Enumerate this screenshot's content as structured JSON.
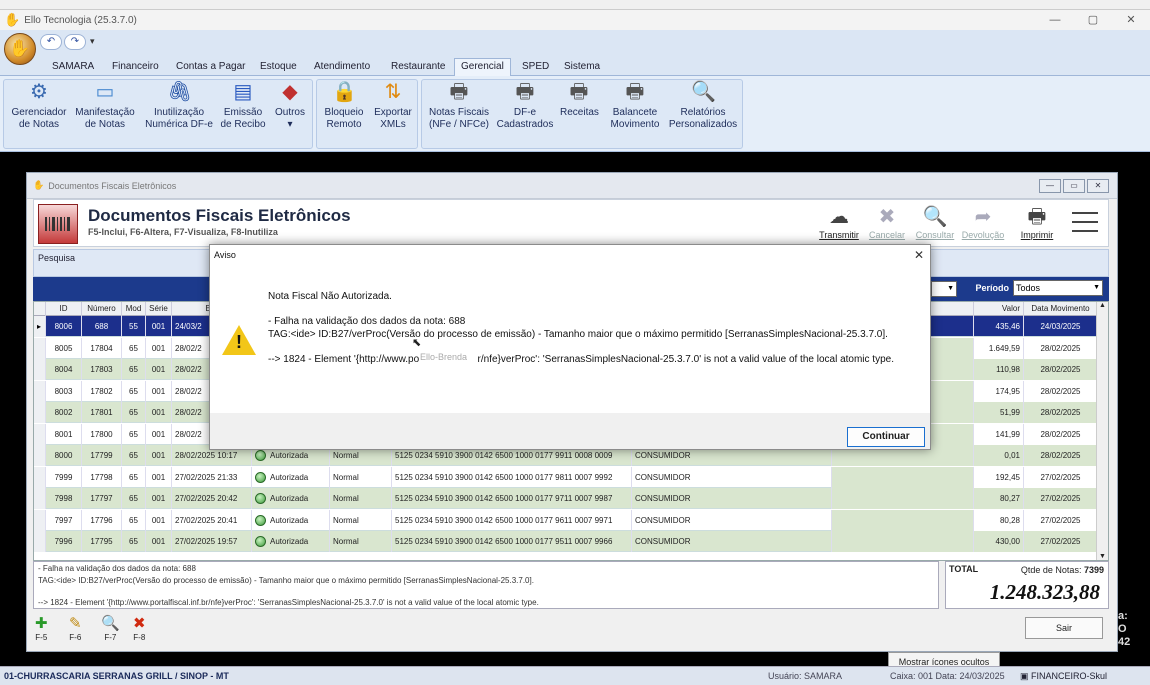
{
  "app": {
    "title": "Ello Tecnologia (25.3.7.0)",
    "min": "—",
    "max": "▢",
    "close": "✕"
  },
  "tabs": [
    {
      "label": "SAMARA"
    },
    {
      "label": "Financeiro"
    },
    {
      "label": "Contas a Pagar"
    },
    {
      "label": "Estoque"
    },
    {
      "label": "Atendimento"
    },
    {
      "label": "Restaurante"
    },
    {
      "label": "Gerencial"
    },
    {
      "label": "SPED"
    },
    {
      "label": "Sistema"
    }
  ],
  "ribbon": [
    {
      "l1": "Gerenciador",
      "l2": "de Notas",
      "icon": "gear-doc-icon",
      "glyph": "⚙"
    },
    {
      "l1": "Manifestação",
      "l2": "de Notas",
      "icon": "window-icon",
      "glyph": "▭"
    },
    {
      "l1": "Inutilização",
      "l2": "Numérica DF-e",
      "icon": "paperclip-icon",
      "glyph": "🖇"
    },
    {
      "l1": "Emissão",
      "l2": "de Recibo",
      "icon": "calculator-icon",
      "glyph": "▤"
    },
    {
      "l1": "Outros",
      "l2": "▾",
      "icon": "shapes-icon",
      "glyph": "◆"
    },
    {
      "l1": "Bloqueio",
      "l2": "Remoto",
      "icon": "lock-icon",
      "glyph": "🔒"
    },
    {
      "l1": "Exportar",
      "l2": "XMLs",
      "icon": "export-arrows-icon",
      "glyph": "⇅"
    },
    {
      "l1": "Notas Fiscais",
      "l2": "(NFe / NFCe)",
      "icon": "printer-icon",
      "glyph": "🖶"
    },
    {
      "l1": "DF-e",
      "l2": "Cadastrados",
      "icon": "printer-icon",
      "glyph": "🖶"
    },
    {
      "l1": "Receitas",
      "l2": "",
      "icon": "printer-icon",
      "glyph": "🖶"
    },
    {
      "l1": "Balancete",
      "l2": "Movimento",
      "icon": "printer-icon",
      "glyph": "🖶"
    },
    {
      "l1": "Relatórios",
      "l2": "Personalizados",
      "icon": "report-search-icon",
      "glyph": "🔍"
    }
  ],
  "mdi": {
    "title": "Documentos Fiscais Eletrônicos",
    "min": "—",
    "restore": "▭",
    "close": "✕"
  },
  "header": {
    "title": "Documentos Fiscais Eletrônicos",
    "subtitle": "F5-Inclui, F6-Altera, F7-Visualiza, F8-Inutiliza",
    "buttons": [
      {
        "label": "Transmitir",
        "glyph": "☁",
        "icon": "cloud-upload-icon",
        "enabled": true
      },
      {
        "label": "Cancelar",
        "glyph": "✖",
        "icon": "cancel-icon",
        "enabled": false
      },
      {
        "label": "Consultar",
        "glyph": "🔍",
        "icon": "consult-icon",
        "enabled": false
      },
      {
        "label": "Devolução",
        "glyph": "➦",
        "icon": "return-arrow-icon",
        "enabled": false
      },
      {
        "label": "Imprimir",
        "glyph": "🖶",
        "icon": "printer-icon",
        "enabled": true
      }
    ]
  },
  "search": {
    "label": "Pesquisa"
  },
  "periodo": {
    "label": "Período",
    "value": "Todos"
  },
  "grid": {
    "columns": {
      "id": "ID",
      "numero": "Número",
      "mod": "Mod",
      "serie": "Série",
      "em": "Em",
      "valor": "Valor",
      "data": "Data Movimento"
    },
    "rows": [
      {
        "id": "8006",
        "num": "688",
        "mod": "55",
        "serie": "001",
        "em": "24/03/2",
        "status": "",
        "tipo": "",
        "chave": "",
        "dest": "",
        "valor": "435,46",
        "data": "24/03/2025"
      },
      {
        "id": "8005",
        "num": "17804",
        "mod": "65",
        "serie": "001",
        "em": "28/02/2",
        "status": "",
        "tipo": "",
        "chave": "",
        "dest": "",
        "valor": "1.649,59",
        "data": "28/02/2025"
      },
      {
        "id": "8004",
        "num": "17803",
        "mod": "65",
        "serie": "001",
        "em": "28/02/2",
        "status": "",
        "tipo": "",
        "chave": "",
        "dest": "",
        "valor": "110,98",
        "data": "28/02/2025"
      },
      {
        "id": "8003",
        "num": "17802",
        "mod": "65",
        "serie": "001",
        "em": "28/02/2",
        "status": "",
        "tipo": "",
        "chave": "",
        "dest": "",
        "valor": "174,95",
        "data": "28/02/2025"
      },
      {
        "id": "8002",
        "num": "17801",
        "mod": "65",
        "serie": "001",
        "em": "28/02/2",
        "status": "",
        "tipo": "",
        "chave": "",
        "dest": "",
        "valor": "51,99",
        "data": "28/02/2025"
      },
      {
        "id": "8001",
        "num": "17800",
        "mod": "65",
        "serie": "001",
        "em": "28/02/2",
        "status": "",
        "tipo": "",
        "chave": "",
        "dest": "",
        "valor": "141,99",
        "data": "28/02/2025"
      },
      {
        "id": "8000",
        "num": "17799",
        "mod": "65",
        "serie": "001",
        "em": "28/02/2025 10:17",
        "status": "Autorizada",
        "tipo": "Normal",
        "chave": "5125 0234 5910 3900 0142 6500 1000 0177 9911 0008 0009",
        "dest": "CONSUMIDOR",
        "valor": "0,01",
        "data": "28/02/2025"
      },
      {
        "id": "7999",
        "num": "17798",
        "mod": "65",
        "serie": "001",
        "em": "27/02/2025 21:33",
        "status": "Autorizada",
        "tipo": "Normal",
        "chave": "5125 0234 5910 3900 0142 6500 1000 0177 9811 0007 9992",
        "dest": "CONSUMIDOR",
        "valor": "192,45",
        "data": "27/02/2025"
      },
      {
        "id": "7998",
        "num": "17797",
        "mod": "65",
        "serie": "001",
        "em": "27/02/2025 20:42",
        "status": "Autorizada",
        "tipo": "Normal",
        "chave": "5125 0234 5910 3900 0142 6500 1000 0177 9711 0007 9987",
        "dest": "CONSUMIDOR",
        "valor": "80,27",
        "data": "27/02/2025"
      },
      {
        "id": "7997",
        "num": "17796",
        "mod": "65",
        "serie": "001",
        "em": "27/02/2025 20:41",
        "status": "Autorizada",
        "tipo": "Normal",
        "chave": "5125 0234 5910 3900 0142 6500 1000 0177 9611 0007 9971",
        "dest": "CONSUMIDOR",
        "valor": "80,28",
        "data": "27/02/2025"
      },
      {
        "id": "7996",
        "num": "17795",
        "mod": "65",
        "serie": "001",
        "em": "27/02/2025 19:57",
        "status": "Autorizada",
        "tipo": "Normal",
        "chave": "5125 0234 5910 3900 0142 6500 1000 0177 9511 0007 9966",
        "dest": "CONSUMIDOR",
        "valor": "430,00",
        "data": "27/02/2025"
      }
    ]
  },
  "info": {
    "line1": "- Falha na validação dos dados da nota: 688",
    "line2": "TAG:<ide> ID:B27/verProc(Versão do processo de emissão) - Tamanho maior que o máximo permitido [SerranasSimplesNacional-25.3.7.0].",
    "line3": "--> 1824 - Element '{http://www.portalfiscal.inf.br/nfe}verProc': 'SerranasSimplesNacional-25.3.7.0' is not a valid value of the local atomic type."
  },
  "total": {
    "label": "TOTAL",
    "qtd_label": "Qtde de Notas:",
    "qtd": "7399",
    "value": "1.248.323,88"
  },
  "fkeys": [
    {
      "label": "F-5",
      "icon": "add-icon",
      "glyph": "✚",
      "color": "#2a9a2a"
    },
    {
      "label": "F-6",
      "icon": "edit-pencil-icon",
      "glyph": "✎",
      "color": "#c08a10"
    },
    {
      "label": "F-7",
      "icon": "magnifier-icon",
      "glyph": "🔍",
      "color": "#1a6a2a"
    },
    {
      "label": "F-8",
      "icon": "delete-x-icon",
      "glyph": "✖",
      "color": "#d02a10"
    }
  ],
  "sair": "Sair",
  "dialog": {
    "title": "Aviso",
    "close": "✕",
    "l1": "Nota Fiscal Não Autorizada.",
    "l2": "- Falha na validação dos dados da nota: 688",
    "l3": "TAG:<ide> ID:B27/verProc(Versão do processo de emissão) - Tamanho maior que o máximo permitido [SerranasSimplesNacional-25.3.7.0].",
    "l4": "--> 1824 - Element '{http://www.po                     r/nfe}verProc': 'SerranasSimplesNacional-25.3.7.0' is not a valid value of the local atomic type.",
    "button": "Continuar",
    "watermark": "Ello-Brenda"
  },
  "status": {
    "company": "01-CHURRASCARIA SERRANAS GRILL / SINOP - MT",
    "user": "Usuário: SAMARA",
    "caixa": "Caixa: 001 Data: 24/03/2025",
    "module": "FINANCEIRO-Skul"
  },
  "tooltip": "Mostrar ícones ocultos"
}
